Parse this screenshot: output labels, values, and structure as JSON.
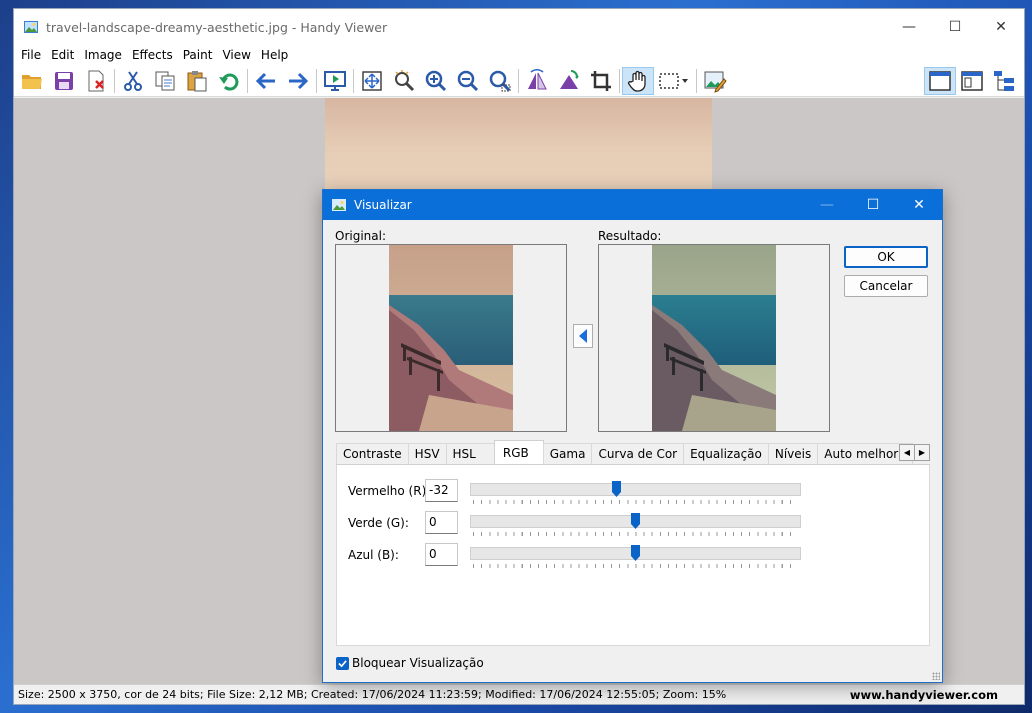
{
  "window": {
    "title": "travel-landscape-dreamy-aesthetic.jpg - Handy Viewer",
    "minimize": "—",
    "maximize": "☐",
    "close": "✕"
  },
  "menu": [
    "File",
    "Edit",
    "Image",
    "Effects",
    "Paint",
    "View",
    "Help"
  ],
  "toolbar_icons": [
    "open-folder-icon",
    "save-icon",
    "delete-icon",
    "cut-icon",
    "copy-icon",
    "paste-icon",
    "undo-icon",
    "back-arrow-icon",
    "forward-arrow-icon",
    "slideshow-icon",
    "fit-icon",
    "auto-zoom-icon",
    "zoom-in-icon",
    "zoom-out-icon",
    "zoom-actual-icon",
    "flip-icon",
    "rotate-icon",
    "crop-icon",
    "hand-icon",
    "select-rect-icon",
    "edit-image-icon",
    "layout-icon",
    "window-icon",
    "tree-icon"
  ],
  "status": {
    "info": "Size: 2500 x 3750, cor de 24 bits; File Size: 2,12 MB; Created: 17/06/2024 11:23:59; Modified: 17/06/2024 12:55:05; Zoom: 15%",
    "site": "www.handyviewer.com"
  },
  "dialog": {
    "title": "Visualizar",
    "original_label": "Original:",
    "result_label": "Resultado:",
    "ok": "OK",
    "cancel": "Cancelar",
    "tabs": [
      "Contraste",
      "HSV",
      "HSL",
      "RGB",
      "Gama",
      "Curva de Cor",
      "Equalização",
      "Níveis",
      "Auto melhoramento"
    ],
    "active_tab": "RGB",
    "rows": [
      {
        "label": "Vermelho (R):",
        "value": "-32",
        "fraction": 0.44
      },
      {
        "label": "Verde (G):",
        "value": "0",
        "fraction": 0.5
      },
      {
        "label": "Azul (B):",
        "value": "0",
        "fraction": 0.5
      }
    ],
    "lock_label": "Bloquear Visualização",
    "lock_checked": true
  },
  "colors": {
    "accent": "#0a6fd8",
    "canvas": "#cbc7c7"
  }
}
